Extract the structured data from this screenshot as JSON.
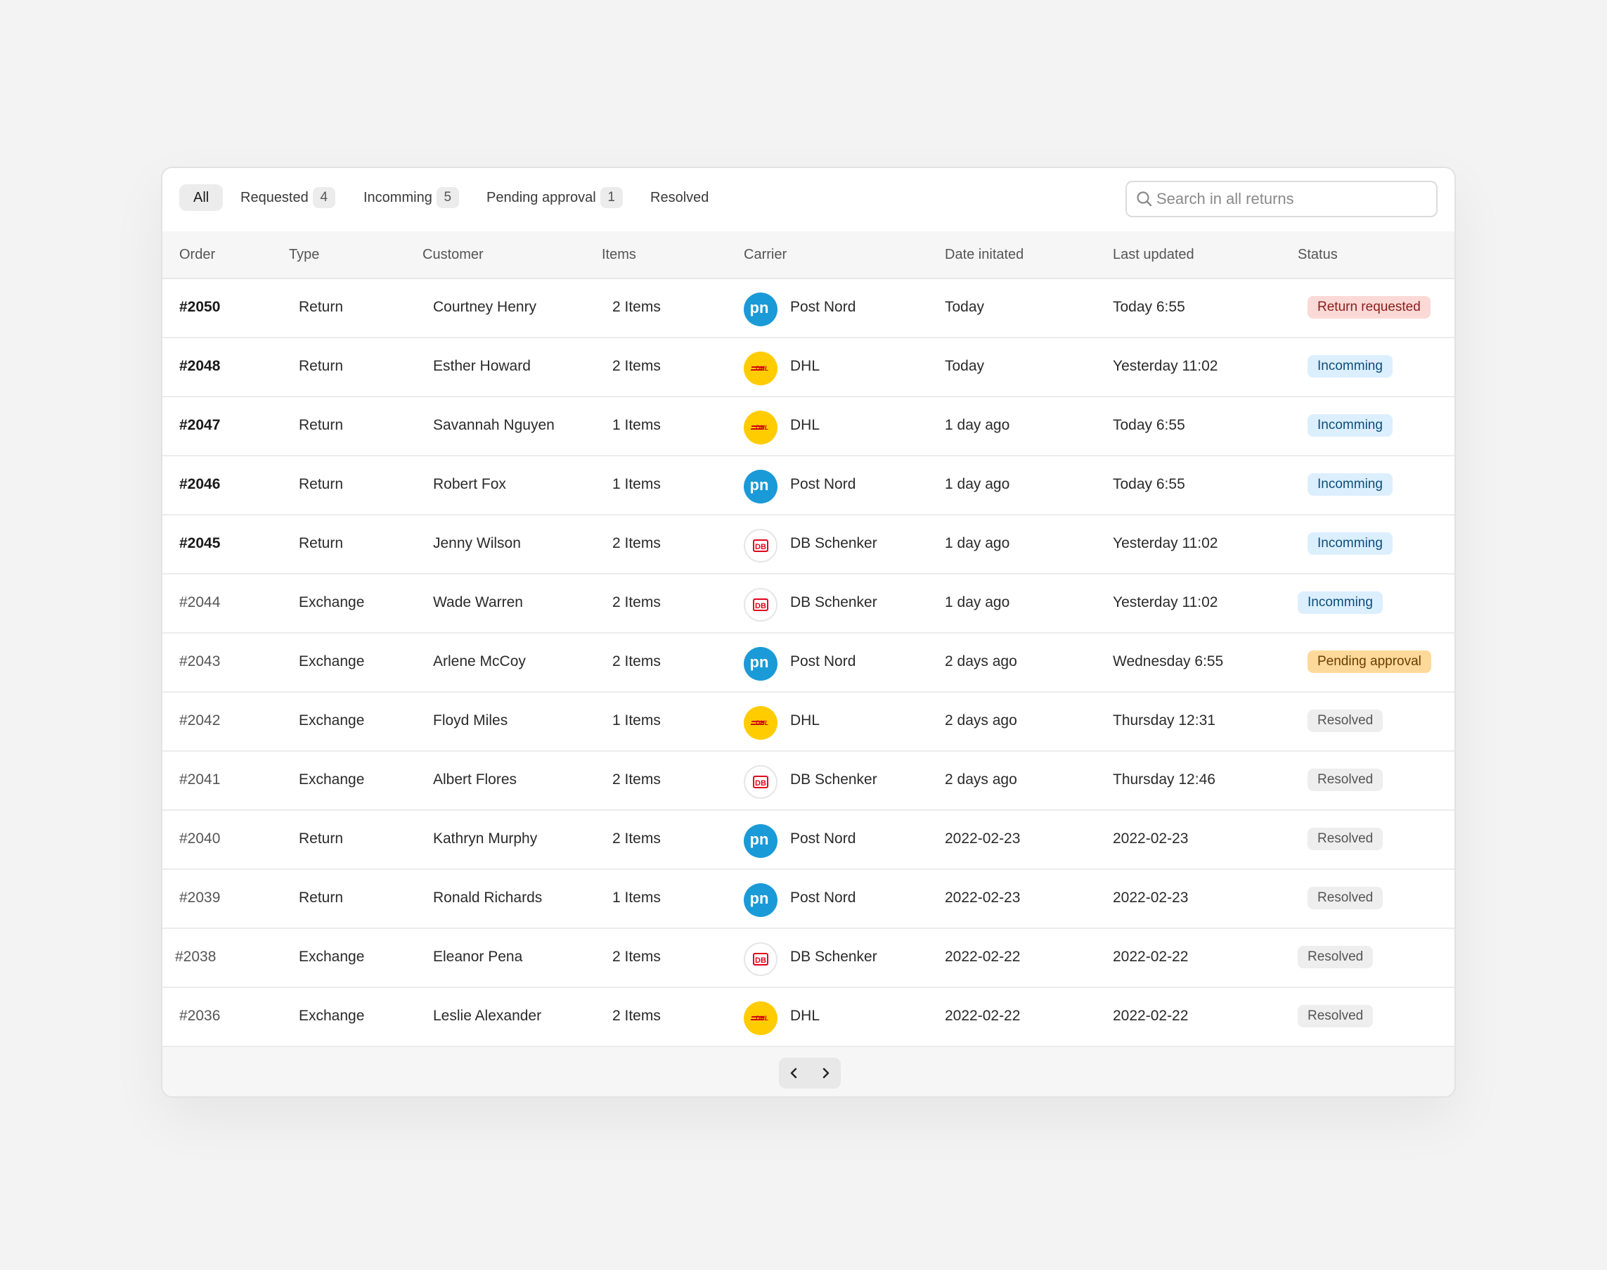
{
  "tabs": [
    {
      "label": "All",
      "count": null
    },
    {
      "label": "Requested",
      "count": "4"
    },
    {
      "label": "Incomming",
      "count": "5"
    },
    {
      "label": "Pending approval",
      "count": "1"
    },
    {
      "label": "Resolved",
      "count": null
    }
  ],
  "search": {
    "placeholder": "Search in all returns",
    "value": ""
  },
  "columns": {
    "order": "Order",
    "type": "Type",
    "customer": "Customer",
    "items": "Items",
    "carrier": "Carrier",
    "date_initiated": "Date initated",
    "last_updated": "Last updated",
    "status": "Status"
  },
  "rows": [
    {
      "order": "#2050",
      "type": "Return",
      "customer": "Courtney Henry",
      "items": "2 Items",
      "carrier": "Post Nord",
      "carrier_logo": "pn",
      "date": "Today",
      "updated": "Today 6:55",
      "status": "Return requested",
      "status_kind": "requested"
    },
    {
      "order": "#2048",
      "type": "Return",
      "customer": "Esther Howard",
      "items": "2 Items",
      "carrier": "DHL",
      "carrier_logo": "dhl",
      "date": "Today",
      "updated": "Yesterday 11:02",
      "status": "Incomming",
      "status_kind": "incoming"
    },
    {
      "order": "#2047",
      "type": "Return",
      "customer": "Savannah Nguyen",
      "items": "1 Items",
      "carrier": "DHL",
      "carrier_logo": "dhl",
      "date": "1 day ago",
      "updated": "Today 6:55",
      "status": "Incomming",
      "status_kind": "incoming"
    },
    {
      "order": "#2046",
      "type": "Return",
      "customer": "Robert Fox",
      "items": "1 Items",
      "carrier": "Post Nord",
      "carrier_logo": "pn",
      "date": "1 day ago",
      "updated": "Today 6:55",
      "status": "Incomming",
      "status_kind": "incoming"
    },
    {
      "order": "#2045",
      "type": "Return",
      "customer": "Jenny Wilson",
      "items": "2 Items",
      "carrier": "DB Schenker",
      "carrier_logo": "db",
      "date": "1 day ago",
      "updated": "Yesterday 11:02",
      "status": "Incomming",
      "status_kind": "incoming"
    },
    {
      "order": "#2044",
      "type": "Exchange",
      "customer": "Wade Warren",
      "items": "2 Items",
      "carrier": "DB Schenker",
      "carrier_logo": "db",
      "date": "1 day ago",
      "updated": "Yesterday 11:02",
      "status": "Incomming",
      "status_kind": "incoming"
    },
    {
      "order": "#2043",
      "type": "Exchange",
      "customer": "Arlene McCoy",
      "items": "2 Items",
      "carrier": "Post Nord",
      "carrier_logo": "pn",
      "date": "2 days ago",
      "updated": "Wednesday 6:55",
      "status": "Pending approval",
      "status_kind": "pending"
    },
    {
      "order": "#2042",
      "type": "Exchange",
      "customer": "Floyd Miles",
      "items": "1 Items",
      "carrier": "DHL",
      "carrier_logo": "dhl",
      "date": "2 days ago",
      "updated": "Thursday 12:31",
      "status": "Resolved",
      "status_kind": "resolved"
    },
    {
      "order": "#2041",
      "type": "Exchange",
      "customer": "Albert Flores",
      "items": "2 Items",
      "carrier": "DB Schenker",
      "carrier_logo": "db",
      "date": "2 days ago",
      "updated": "Thursday 12:46",
      "status": "Resolved",
      "status_kind": "resolved"
    },
    {
      "order": "#2040",
      "type": "Return",
      "customer": "Kathryn Murphy",
      "items": "2 Items",
      "carrier": "Post Nord",
      "carrier_logo": "pn",
      "date": "2022-02-23",
      "updated": "2022-02-23",
      "status": "Resolved",
      "status_kind": "resolved"
    },
    {
      "order": "#2039",
      "type": "Return",
      "customer": "Ronald Richards",
      "items": "1 Items",
      "carrier": "Post Nord",
      "carrier_logo": "pn",
      "date": "2022-02-23",
      "updated": "2022-02-23",
      "status": "Resolved",
      "status_kind": "resolved"
    },
    {
      "order": "#2038",
      "type": "Exchange",
      "customer": "Eleanor Pena",
      "items": "2 Items",
      "carrier": "DB Schenker",
      "carrier_logo": "db",
      "date": "2022-02-22",
      "updated": "2022-02-22",
      "status": "Resolved",
      "status_kind": "resolved"
    },
    {
      "order": "#2036",
      "type": "Exchange",
      "customer": "Leslie Alexander",
      "items": "2 Items",
      "carrier": "DHL",
      "carrier_logo": "dhl",
      "date": "2022-02-22",
      "updated": "2022-02-22",
      "status": "Resolved",
      "status_kind": "resolved"
    }
  ],
  "logos": {
    "pn": {
      "text": "pn",
      "icon": "postnord-logo-icon",
      "color": "#1a9ad6"
    },
    "dhl": {
      "text": "DHL",
      "icon": "dhl-logo-icon",
      "color": "#ffcc00"
    },
    "db": {
      "text": "DB",
      "icon": "db-schenker-logo-icon",
      "color": "#e3001b"
    }
  },
  "pagination": {
    "prev_icon": "chevron-left-icon",
    "next_icon": "chevron-right-icon"
  },
  "colors": {
    "requested": "#fbd9d6",
    "incoming": "#dcefff",
    "pending": "#ffd99a",
    "resolved": "#eeeeee"
  }
}
